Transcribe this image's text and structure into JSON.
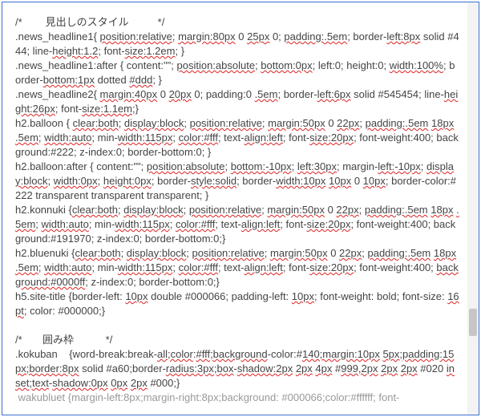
{
  "comment_heading": "/*        見出しのスタイル          */",
  "rules": [
    {
      "selector": ".news_headline1",
      "body": "{ position:relative; margin:80px 0 25px 0; padding:.5em; border-left:8px solid #444; line-height:1.2; font-size:1.2em; }"
    },
    {
      "selector": ".news_headline1:after ",
      "body": "{ content:\"\"; position:absolute; bottom:0px; left:0; height:0; width:100%; border-bottom:1px dotted #ddd; }"
    },
    {
      "selector": ".news_headline2",
      "body": "{ margin:40px 0 20px 0; padding:0 .5em; border-left:6px solid #545454; line-height:26px; font-size:1.1em;}"
    },
    {
      "selector": "h2.balloon ",
      "body": "{ clear:both; display:block; position:relative; margin:50px 0 22px; padding:.5em 18px .5em; width:auto; min-width:115px; color:#fff; text-align:left; font-size:20px; font-weight:400; background:#222; z-index:0; border-bottom:0; }"
    },
    {
      "selector": "h2.balloon:after ",
      "body": "{ content:\"\"; position:absolute; bottom:-10px; left:30px; margin-left:-10px; display:block; width:0px; height:0px; border-style:solid; border-width:10px 10px 0 10px; border-color:#222 transparent transparent transparent; }"
    },
    {
      "selector": "h2.konnuki ",
      "body": "{clear:both; display:block; position:relative; margin:50px 0 22px; padding:.5em 18px .5em; width:auto; min-width:115px; color:#fff; text-align:left; font-size:20px; font-weight:400; background:#191970; z-index:0; border-bottom:0;}"
    },
    {
      "selector": "h2.bluenuki ",
      "body": "{clear:both; display:block; position:relative; margin:50px 0 22px; padding:.5em 18px .5em; width:auto; min-width:115px; color:#fff; text-align:left; font-size:20px; font-weight:400; background:#0000ff; z-index:0; border-bottom:0;}"
    },
    {
      "selector": "h5.site-title ",
      "body": "{border-left: 10px double #000066; padding-left: 10px; font-weight: bold; font-size: 16pt; color: #000000;}"
    }
  ],
  "comment_box": "/*       囲み枠           */",
  "rules2": [
    {
      "selector": ".kokuban    ",
      "body": "{word-break:break-all;color:#fff;background-color:#140;margin:10px 5px;padding:15px;border:8px solid #a60;border-radius:3px;box-shadow:2px 2px 4px #999,2px 2px 2px #020 inset;text-shadow:0px 0px 2px #000;}"
    }
  ],
  "cutoff_line": " wakubluet {margin-left:8px;margin-right:8px;background: #000066;color:#ffffff; font-"
}
